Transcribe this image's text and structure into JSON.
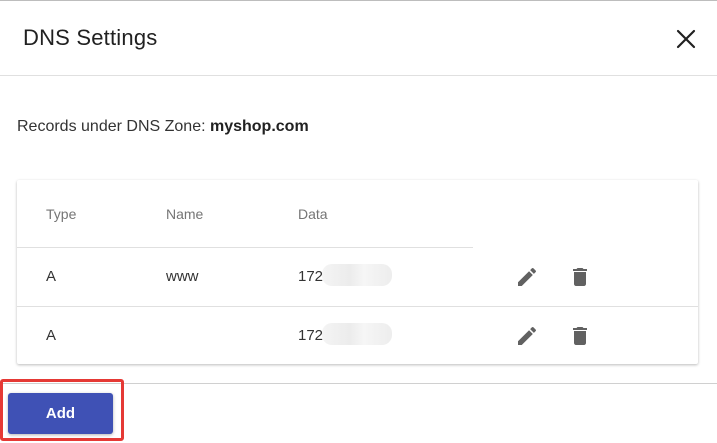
{
  "dialog": {
    "title": "DNS Settings",
    "close_icon": "close-icon"
  },
  "zone": {
    "prefix": "Records under DNS Zone: ",
    "name": "myshop.com"
  },
  "table": {
    "columns": [
      "Type",
      "Name",
      "Data"
    ],
    "rows": [
      {
        "type": "A",
        "name": "www",
        "data": "172",
        "actions": [
          "edit-icon",
          "delete-icon"
        ]
      },
      {
        "type": "A",
        "name": "",
        "data": "172",
        "actions": [
          "edit-icon",
          "delete-icon"
        ]
      }
    ]
  },
  "footer": {
    "add_label": "Add"
  },
  "colors": {
    "primary": "#3f51b5",
    "highlight": "#e53935",
    "icon": "#616161"
  }
}
